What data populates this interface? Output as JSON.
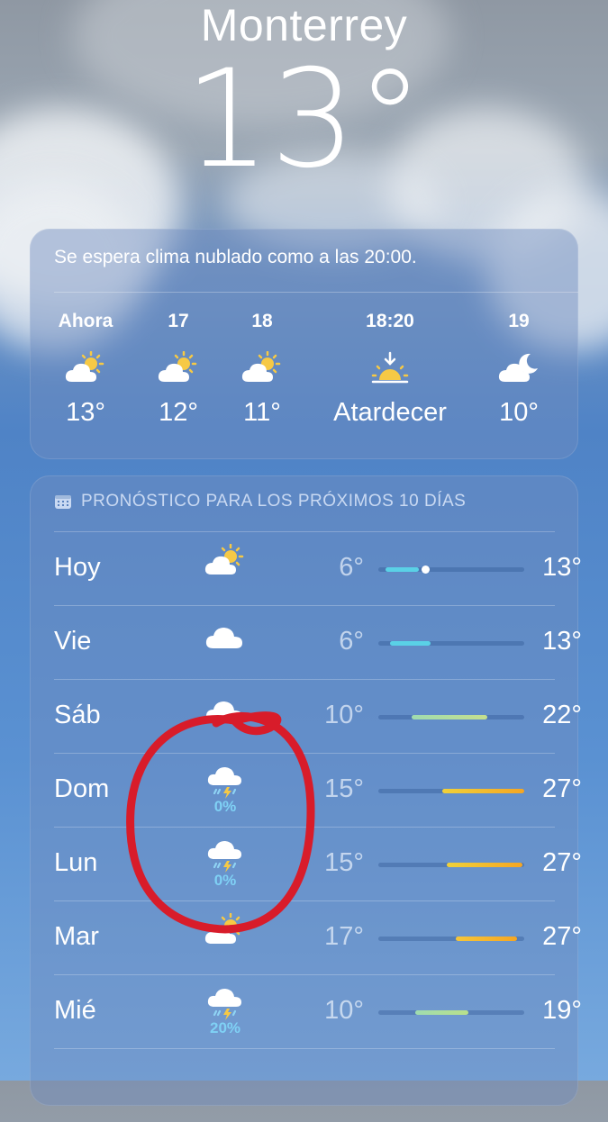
{
  "header": {
    "city": "Monterrey",
    "temperature": "13°"
  },
  "hourly": {
    "summary": "Se espera clima nublado como a las 20:00.",
    "items": [
      {
        "time": "Ahora",
        "icon": "partly-cloudy-sun-icon",
        "value": "13°"
      },
      {
        "time": "17",
        "icon": "partly-cloudy-sun-icon",
        "value": "12°"
      },
      {
        "time": "18",
        "icon": "partly-cloudy-sun-icon",
        "value": "11°"
      },
      {
        "time": "18:20",
        "icon": "sunset-icon",
        "value": "Atardecer"
      },
      {
        "time": "19",
        "icon": "partly-cloudy-moon-icon",
        "value": "10°"
      }
    ]
  },
  "forecast": {
    "title": "PRONÓSTICO PARA LOS PRÓXIMOS 10 DÍAS",
    "days": [
      {
        "day": "Hoy",
        "icon": "partly-cloudy-sun-icon",
        "low": "6°",
        "high": "13°",
        "bar_start": 0.05,
        "bar_end": 0.28,
        "current": 0.32,
        "colors": [
          "#5ad1e6",
          "#5ad1e6"
        ]
      },
      {
        "day": "Vie",
        "icon": "cloud-icon",
        "low": "6°",
        "high": "13°",
        "bar_start": 0.08,
        "bar_end": 0.36,
        "colors": [
          "#5ad1e6",
          "#5ad1e6"
        ]
      },
      {
        "day": "Sáb",
        "icon": "cloud-icon",
        "low": "10°",
        "high": "22°",
        "bar_start": 0.23,
        "bar_end": 0.75,
        "colors": [
          "#9fdcb0",
          "#c6df8e"
        ]
      },
      {
        "day": "Dom",
        "icon": "thunderstorm-icon",
        "pop": "0%",
        "low": "15°",
        "high": "27°",
        "bar_start": 0.44,
        "bar_end": 1.0,
        "colors": [
          "#f0d13a",
          "#f5a623"
        ]
      },
      {
        "day": "Lun",
        "icon": "thunderstorm-icon",
        "pop": "0%",
        "low": "15°",
        "high": "27°",
        "bar_start": 0.47,
        "bar_end": 0.99,
        "colors": [
          "#f0d13a",
          "#f5a623"
        ]
      },
      {
        "day": "Mar",
        "icon": "partly-cloudy-sun-icon",
        "low": "17°",
        "high": "27°",
        "bar_start": 0.53,
        "bar_end": 0.95,
        "colors": [
          "#f5c63a",
          "#f5a623"
        ]
      },
      {
        "day": "Mié",
        "icon": "thunderstorm-icon",
        "pop": "20%",
        "low": "10°",
        "high": "19°",
        "bar_start": 0.25,
        "bar_end": 0.62,
        "colors": [
          "#9fdcb0",
          "#b9e08a"
        ]
      }
    ]
  },
  "annotation": {
    "color": "#d81c2a"
  }
}
